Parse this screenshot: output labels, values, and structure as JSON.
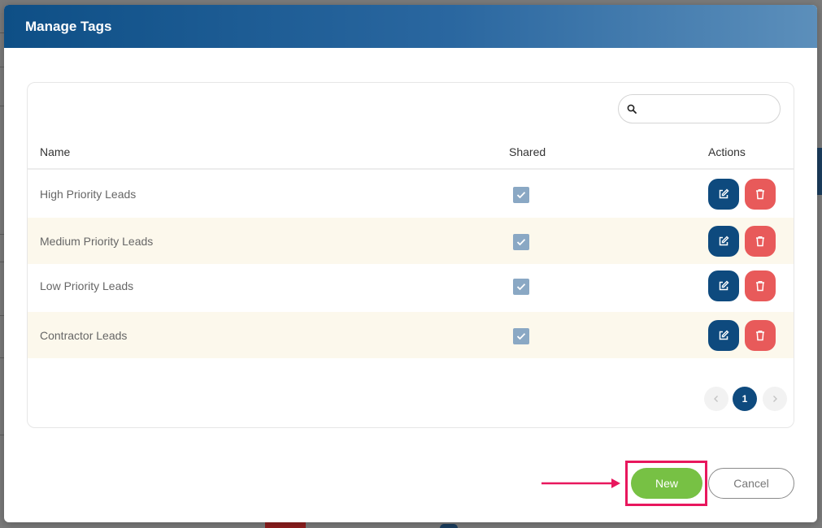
{
  "modal": {
    "title": "Manage Tags"
  },
  "search": {
    "placeholder": "",
    "value": ""
  },
  "table": {
    "columns": [
      "Name",
      "Shared",
      "Actions"
    ],
    "rows": [
      {
        "name": "High Priority Leads",
        "shared": true
      },
      {
        "name": "Medium Priority Leads",
        "shared": true
      },
      {
        "name": "Low Priority Leads",
        "shared": true
      },
      {
        "name": "Contractor Leads",
        "shared": true
      }
    ]
  },
  "pagination": {
    "current_page": "1",
    "prev_icon": "chevron-left-icon",
    "next_icon": "chevron-right-icon"
  },
  "footer": {
    "new_label": "New",
    "cancel_label": "Cancel"
  },
  "colors": {
    "header_start": "#0e4f86",
    "header_end": "#5c8fbb",
    "edit_button": "#0e4a7e",
    "delete_button": "#e85a5a",
    "new_button": "#77c144",
    "highlight": "#e8175d",
    "row_alt": "#fcf8ec",
    "checkbox": "#8aa8c4"
  },
  "icons": {
    "search": "search-icon",
    "edit": "edit-icon",
    "delete": "trash-icon",
    "check": "check-icon",
    "annotation_arrow": "arrow-right-icon"
  }
}
